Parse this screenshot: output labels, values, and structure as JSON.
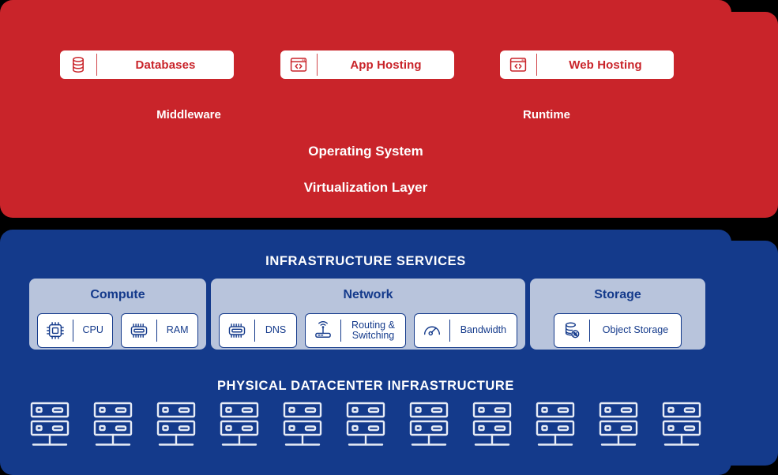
{
  "theme": {
    "paas_color": "#C9242A",
    "iaas_color": "#143A8B",
    "subpanel_color": "#B8C4DC",
    "chip_bg": "#FFFFFF",
    "text_on_dark": "#FFFFFF"
  },
  "paas_layer": {
    "chips": [
      {
        "label": "Databases",
        "icon": "database-icon"
      },
      {
        "label": "App Hosting",
        "icon": "code-window-icon"
      },
      {
        "label": "Web Hosting",
        "icon": "code-window-icon"
      }
    ],
    "stack_labels": [
      {
        "label": "Middleware",
        "size": 15
      },
      {
        "label": "Runtime",
        "size": 15
      },
      {
        "label": "Operating System",
        "size": 17
      },
      {
        "label": "Virtualization Layer",
        "size": 17
      }
    ]
  },
  "iaas_layer": {
    "services_heading": "INFRASTRUCTURE SERVICES",
    "physical_heading": "PHYSICAL DATACENTER INFRASTRUCTURE",
    "panels": [
      {
        "title": "Compute",
        "services": [
          {
            "label": "CPU",
            "icon": "cpu-chip-icon"
          },
          {
            "label": "RAM",
            "icon": "memory-module-icon"
          }
        ]
      },
      {
        "title": "Network",
        "services": [
          {
            "label": "DNS",
            "icon": "memory-module-icon"
          },
          {
            "label": "Routing &\nSwitching",
            "icon": "router-wifi-icon"
          },
          {
            "label": "Bandwidth",
            "icon": "speedometer-icon"
          }
        ]
      },
      {
        "title": "Storage",
        "services": [
          {
            "label": "Object Storage",
            "icon": "object-storage-icon"
          }
        ]
      }
    ],
    "server_count": 11
  }
}
